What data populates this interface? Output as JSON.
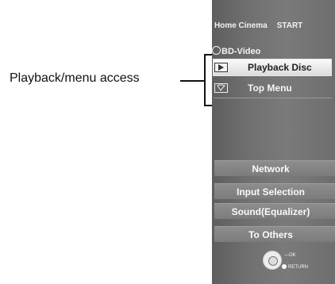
{
  "annotation": {
    "label": "Playback/menu access"
  },
  "menu": {
    "header_title": "Home Cinema",
    "header_start": "START",
    "source": "BD-Video",
    "items": [
      {
        "label": "Playback Disc",
        "icon": "play-icon",
        "selected": true
      },
      {
        "label": "Top Menu",
        "icon": "menu-icon",
        "selected": false
      }
    ],
    "buttons": [
      {
        "label": "Network"
      },
      {
        "label": "Input Selection"
      },
      {
        "label": "Sound(Equalizer)"
      },
      {
        "label": "To Others"
      }
    ],
    "footer": {
      "ok": "OK",
      "return": "RETURN"
    }
  }
}
